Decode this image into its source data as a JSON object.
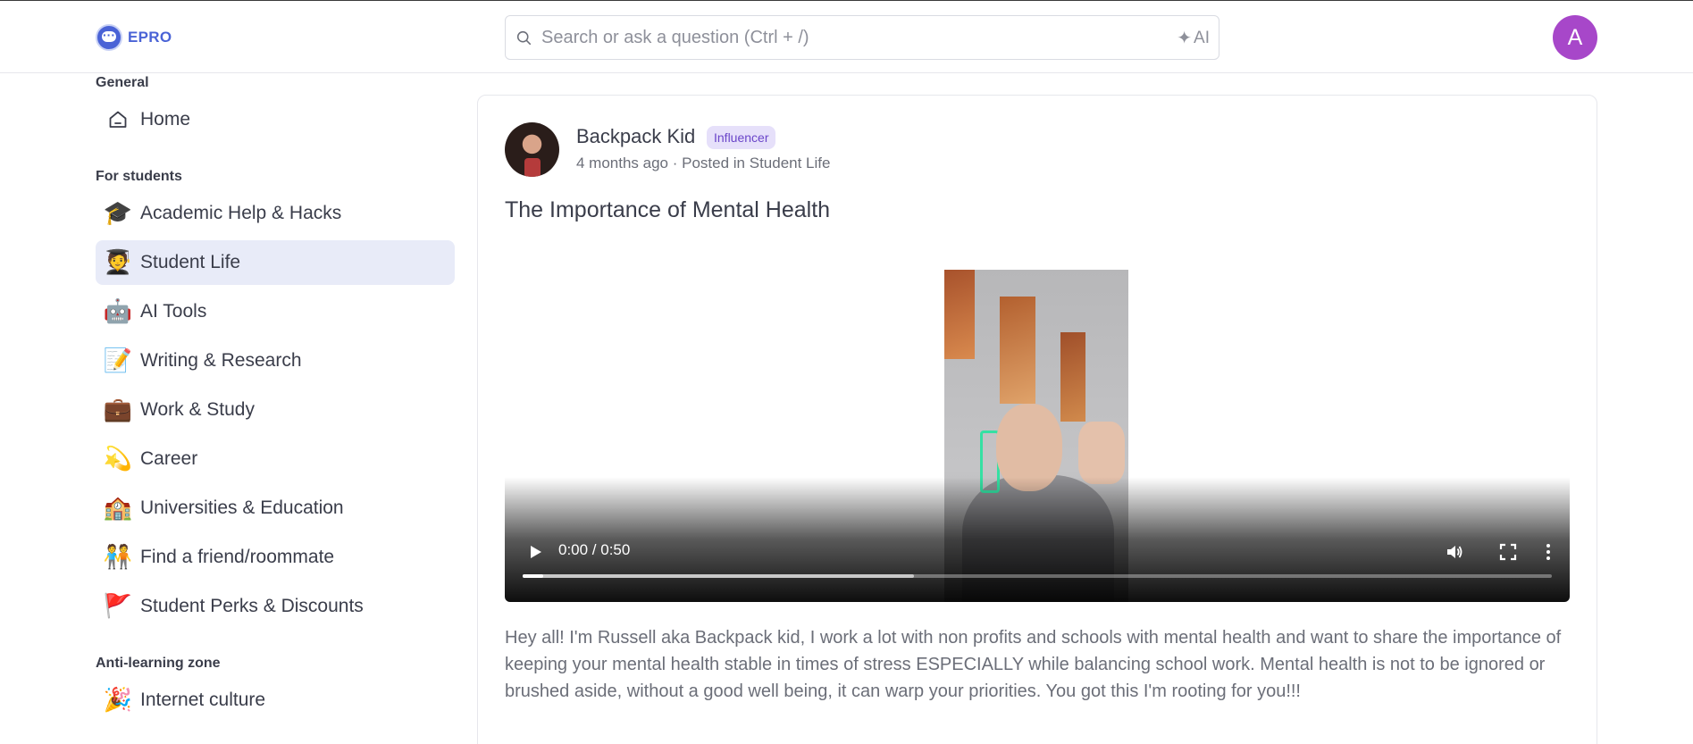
{
  "app": {
    "logo_text": "EPRO"
  },
  "search": {
    "placeholder": "Search or ask a question (Ctrl + /)",
    "ai_label": "AI"
  },
  "user": {
    "avatar_initial": "A",
    "avatar_color": "#a747c9"
  },
  "sidebar": {
    "sections": [
      {
        "title": "General",
        "items": [
          {
            "label": "Home",
            "icon": "home-icon",
            "active": false
          }
        ]
      },
      {
        "title": "For students",
        "items": [
          {
            "label": "Academic Help & Hacks",
            "emoji": "🎓",
            "active": false
          },
          {
            "label": "Student Life",
            "emoji": "🧑‍🎓",
            "active": true
          },
          {
            "label": "AI Tools",
            "emoji": "🤖",
            "active": false
          },
          {
            "label": "Writing & Research",
            "emoji": "📝",
            "active": false
          },
          {
            "label": "Work & Study",
            "emoji": "💼",
            "active": false
          },
          {
            "label": "Career",
            "emoji": "💫",
            "active": false
          },
          {
            "label": "Universities & Education",
            "emoji": "🏫",
            "active": false
          },
          {
            "label": "Find a friend/roommate",
            "emoji": "🧑‍🤝‍🧑",
            "active": false
          },
          {
            "label": "Student Perks & Discounts",
            "emoji": "🚩",
            "active": false
          }
        ]
      },
      {
        "title": "Anti-learning zone",
        "items": [
          {
            "label": "Internet culture",
            "emoji": "🎉",
            "active": false
          }
        ]
      }
    ]
  },
  "post": {
    "author": "Backpack Kid",
    "badge": "Influencer",
    "meta": "4 months ago · Posted in Student Life",
    "title": "The Importance of Mental Health",
    "video": {
      "time": "0:00 / 0:50",
      "played_fraction": 0.02,
      "buffered_fraction": 0.38
    },
    "body": "Hey all! I'm Russell aka Backpack kid, I work a lot with non profits and schools with mental health and want to share the importance of keeping your mental health stable in times of stress ESPECIALLY while balancing school work. Mental health is not to be ignored or brushed aside, without a good well being, it can warp your priorities. You got this I'm rooting for you!!!"
  },
  "colors": {
    "brand": "#4a63d6",
    "active_nav_bg": "#e8ebf8",
    "badge_bg": "#e6e0fa",
    "badge_text": "#6a45c9"
  }
}
